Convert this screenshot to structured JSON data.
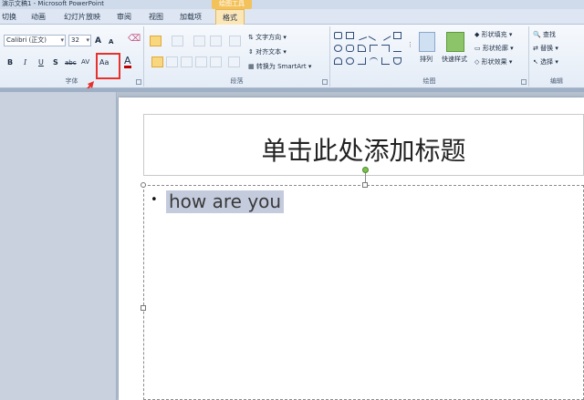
{
  "window": {
    "title": "演示文稿1 - Microsoft PowerPoint",
    "context_banner": "绘图工具"
  },
  "tabs": [
    "切换",
    "动画",
    "幻灯片放映",
    "审阅",
    "视图",
    "加载项",
    "格式"
  ],
  "ribbon": {
    "font": {
      "font_name": "Calibri (正文)",
      "font_size": "32",
      "grow": "A",
      "shrink": "A",
      "bold": "B",
      "italic": "I",
      "underline": "U",
      "strike": "S",
      "abc": "abc",
      "spacing": "AV",
      "change_case": "Aa",
      "font_color": "A",
      "label": "字体"
    },
    "paragraph": {
      "text_direction": "文字方向",
      "align_text": "对齐文本",
      "convert_smartart": "转换为 SmartArt",
      "label": "段落"
    },
    "drawing": {
      "arrange": "排列",
      "quick_styles": "快速样式",
      "shape_fill": "形状填充",
      "shape_outline": "形状轮廓",
      "shape_effects": "形状效果",
      "label": "绘图"
    },
    "editing": {
      "find": "查找",
      "replace": "替换",
      "select": "选择",
      "label": "编辑"
    }
  },
  "slide": {
    "title_placeholder": "单击此处添加标题",
    "bullet": "•",
    "content_text": "how are you"
  },
  "colors": {
    "highlight": "#e8312a",
    "selection": "#c3cbdd"
  }
}
